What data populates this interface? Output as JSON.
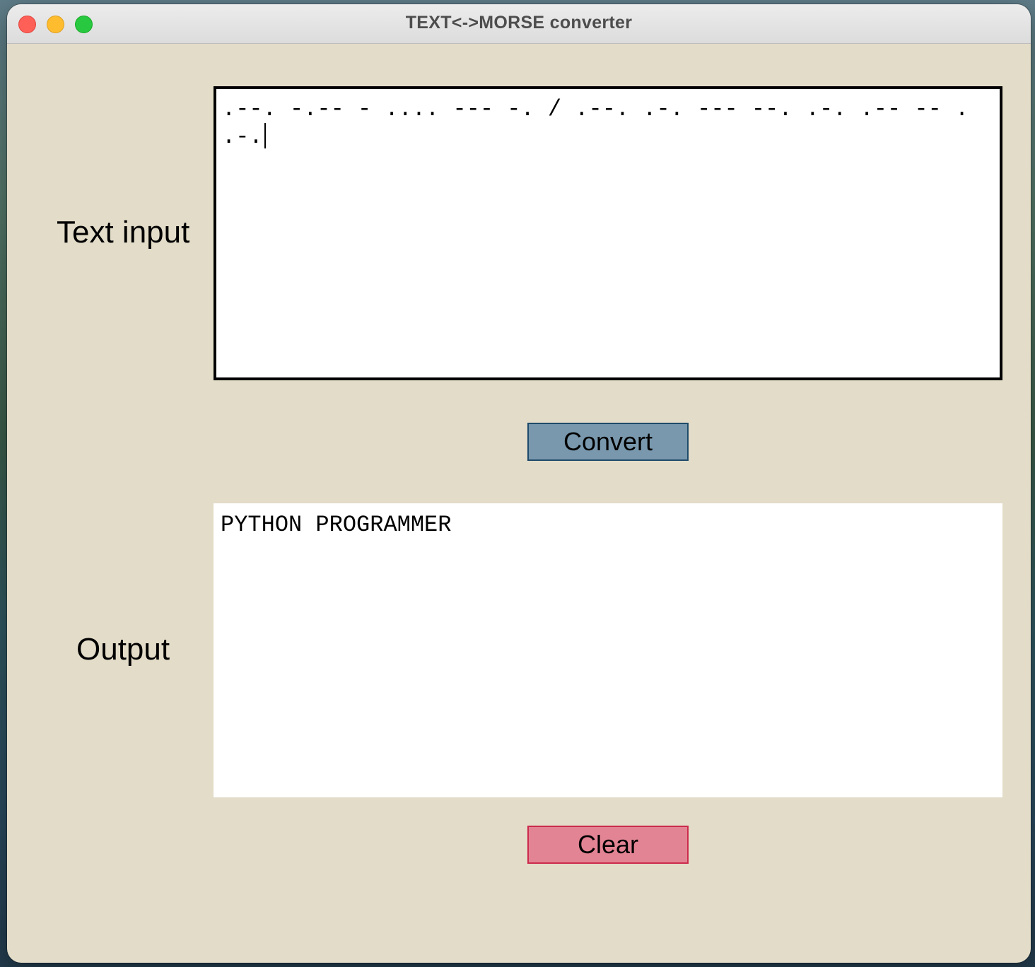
{
  "window": {
    "title": "TEXT<->MORSE converter"
  },
  "input_section": {
    "label": "Text input",
    "value": ".--. -.-- - .... --- -. / .--. .-. --- --. .-. .-- -- . .-."
  },
  "convert_button": {
    "label": "Convert"
  },
  "output_section": {
    "label": "Output",
    "value": "PYTHON PROGRAMMER"
  },
  "clear_button": {
    "label": "Clear"
  },
  "colors": {
    "window_bg": "#e3dcc8",
    "convert_bg": "#7998ad",
    "convert_border": "#1f4a6b",
    "clear_bg": "#e38494",
    "clear_border": "#cc2a4c"
  }
}
